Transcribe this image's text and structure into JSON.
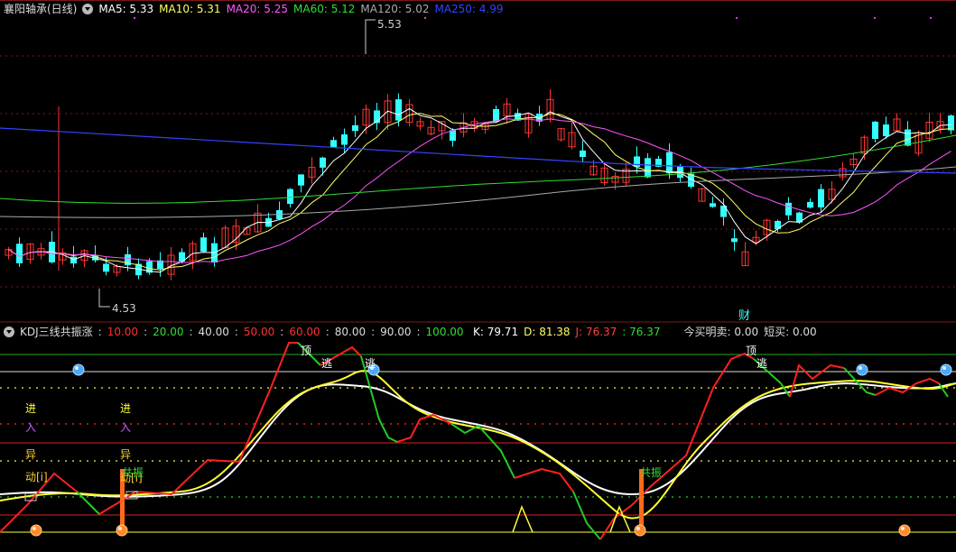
{
  "stock": {
    "name": "襄阳轴承(日线)"
  },
  "ma": [
    {
      "label": "MA5: 5.33",
      "color": "#ffffff"
    },
    {
      "label": "MA10: 5.31",
      "color": "#ffff66"
    },
    {
      "label": "MA20: 5.25",
      "color": "#ff55ff"
    },
    {
      "label": "MA60: 5.12",
      "color": "#33dd33"
    },
    {
      "label": "MA120: 5.02",
      "color": "#aaaaaa"
    },
    {
      "label": "MA250: 4.99",
      "color": "#3344ff"
    }
  ],
  "price_high": "5.53",
  "price_low": "4.53",
  "fin_marker": "财",
  "kdj": {
    "title": "KDJ三线共振涨",
    "params": [
      {
        "v": "10.00",
        "color": "#ff3030"
      },
      {
        "v": "20.00",
        "color": "#33dd33"
      },
      {
        "v": "40.00",
        "color": "#dddddd"
      },
      {
        "v": "50.00",
        "color": "#ff3030"
      },
      {
        "v": "60.00",
        "color": "#ff3030"
      },
      {
        "v": "80.00",
        "color": "#dddddd"
      },
      {
        "v": "90.00",
        "color": "#dddddd"
      },
      {
        "v": "100.00",
        "color": "#33dd33"
      }
    ],
    "values": {
      "k": "K: 79.71",
      "d": "D: 81.38",
      "j": "J: 76.37",
      "extra": ": 76.37",
      "buy": "今买明卖: 0.00",
      "short": "短买: 0.00"
    },
    "signals": {
      "top": "顶",
      "escape": "逃",
      "enter": "进",
      "in": "入",
      "abnormal": "异",
      "move": "动[i]",
      "resonance": "共振"
    }
  },
  "colors": {
    "up": "#ff3333",
    "down": "#33ffff",
    "grid": "#7a1a1a",
    "k_line": "#ffffff",
    "d_line": "#ffff33",
    "j_line": "#ff2020",
    "j_line_down": "#22cc22"
  }
}
